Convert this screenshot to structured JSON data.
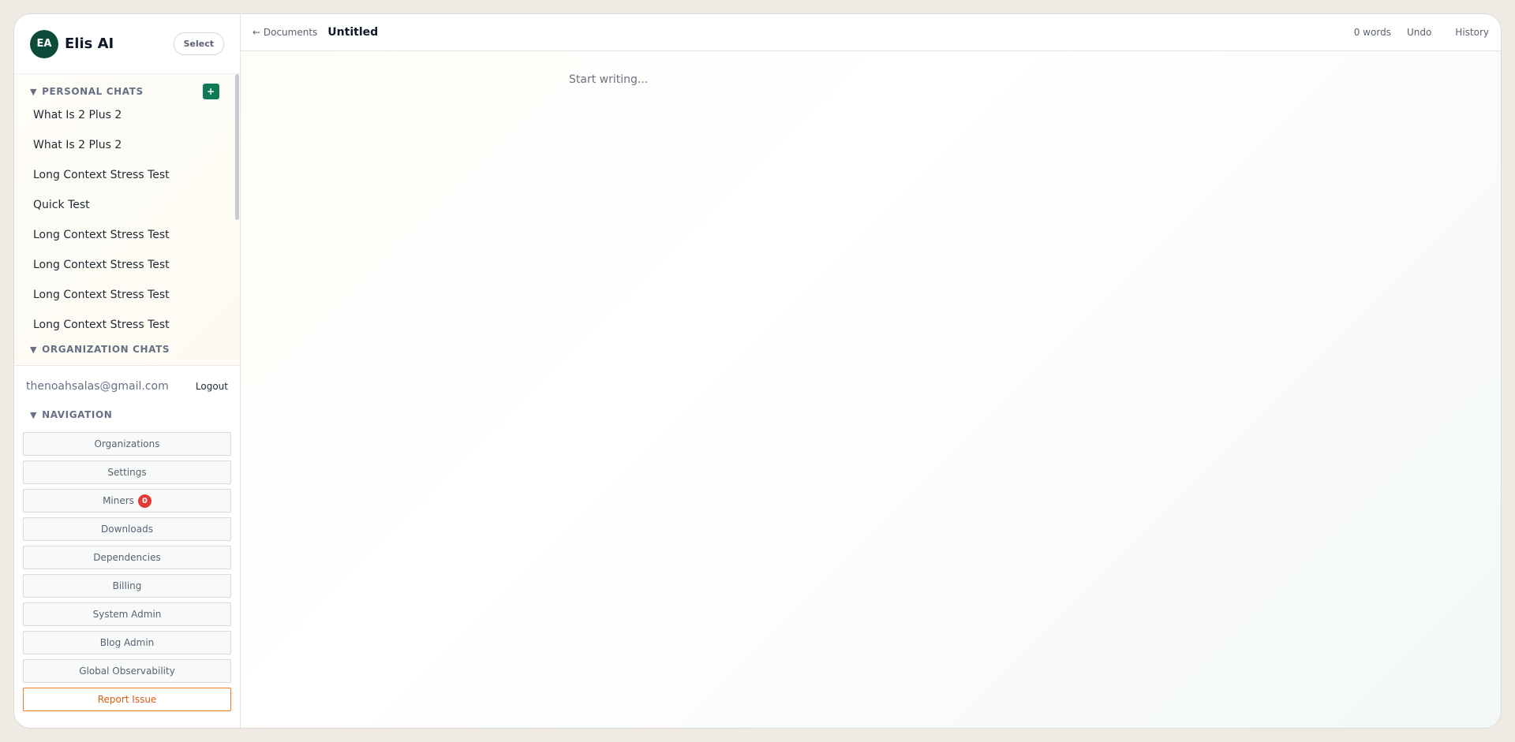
{
  "header": {
    "avatar_initials": "EA",
    "brand_name": "Elis AI",
    "select_label": "Select"
  },
  "personal_chats": {
    "title": "PERSONAL CHATS",
    "add_label": "+",
    "items": [
      "What Is 2 Plus 2",
      "What Is 2 Plus 2",
      "Long Context Stress Test",
      "Quick Test",
      "Long Context Stress Test",
      "Long Context Stress Test",
      "Long Context Stress Test",
      "Long Context Stress Test"
    ]
  },
  "organization_chats": {
    "title": "ORGANIZATION CHATS"
  },
  "user": {
    "email": "thenoahsalas@gmail.com",
    "logout_label": "Logout"
  },
  "navigation": {
    "title": "NAVIGATION",
    "organizations": "Organizations",
    "settings": "Settings",
    "miners": "Miners",
    "miners_badge": "0",
    "downloads": "Downloads",
    "dependencies": "Dependencies",
    "billing": "Billing",
    "system_admin": "System Admin",
    "blog_admin": "Blog Admin",
    "global_observability": "Global Observability",
    "report_issue": "Report Issue"
  },
  "topbar": {
    "back_label": "← Documents",
    "doc_title": "Untitled",
    "word_count": "0 words",
    "undo_label": "Undo",
    "history_label": "History"
  },
  "editor": {
    "placeholder": "Start writing..."
  },
  "colors": {
    "brand_green": "#0d4b3b",
    "accent_green": "#0f7a55",
    "badge_red": "#e53935",
    "report_orange": "#ef7b27"
  }
}
